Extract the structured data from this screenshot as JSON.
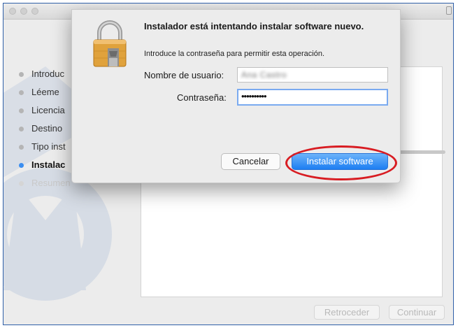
{
  "installer": {
    "steps": [
      {
        "label": "Introduc",
        "state": "done"
      },
      {
        "label": "Léeme",
        "state": "done"
      },
      {
        "label": "Licencia",
        "state": "done"
      },
      {
        "label": "Destino",
        "state": "done"
      },
      {
        "label": "Tipo inst",
        "state": "done"
      },
      {
        "label": "Instalac",
        "state": "active"
      },
      {
        "label": "Resumen",
        "state": "pending"
      }
    ],
    "back_label": "Retroceder",
    "continue_label": "Continuar"
  },
  "dialog": {
    "title": "Instalador está intentando instalar software nuevo.",
    "message": "Introduce la contraseña para permitir esta operación.",
    "username_label": "Nombre de usuario:",
    "username_value": "Ana Castro",
    "password_label": "Contraseña:",
    "password_value": "••••••••••",
    "cancel_label": "Cancelar",
    "install_label": "Instalar software",
    "icon": "padlock-icon"
  },
  "colors": {
    "accent": "#1d7ef2",
    "active_step_dot": "#3b8ef0",
    "highlight_ring": "#d81c22",
    "frame_border": "#2f5fa8"
  }
}
